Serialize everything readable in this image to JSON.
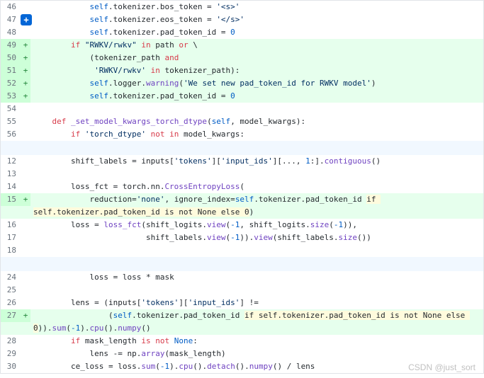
{
  "watermark": "CSDN @just_sort",
  "lines": [
    {
      "n": "46",
      "add": false,
      "parts": [
        [
          "            ",
          ""
        ],
        [
          "self",
          "self"
        ],
        [
          ".tokenizer.bos_token = ",
          ""
        ],
        [
          "'<s>'",
          "str"
        ]
      ]
    },
    {
      "n": "47",
      "add": false,
      "badge": true,
      "parts": [
        [
          "            ",
          ""
        ],
        [
          "self",
          "self"
        ],
        [
          ".tokenizer.eos_token = ",
          ""
        ],
        [
          "'</s>'",
          "str"
        ]
      ]
    },
    {
      "n": "48",
      "add": false,
      "parts": [
        [
          "            ",
          ""
        ],
        [
          "self",
          "self"
        ],
        [
          ".tokenizer.pad_token_id = ",
          ""
        ],
        [
          "0",
          "num"
        ]
      ]
    },
    {
      "n": "49",
      "add": true,
      "parts": [
        [
          "        ",
          ""
        ],
        [
          "if",
          "kw"
        ],
        [
          " ",
          ""
        ],
        [
          "\"RWKV/rwkv\"",
          "str"
        ],
        [
          " ",
          ""
        ],
        [
          "in",
          "kw"
        ],
        [
          " path ",
          ""
        ],
        [
          "or",
          "kw"
        ],
        [
          " \\",
          ""
        ]
      ]
    },
    {
      "n": "50",
      "add": true,
      "parts": [
        [
          "            (tokenizer_path ",
          ""
        ],
        [
          "and",
          "kw"
        ]
      ]
    },
    {
      "n": "51",
      "add": true,
      "parts": [
        [
          "             ",
          ""
        ],
        [
          "'RWKV/rwkv'",
          "str"
        ],
        [
          " ",
          ""
        ],
        [
          "in",
          "kw"
        ],
        [
          " tokenizer_path):",
          ""
        ]
      ]
    },
    {
      "n": "52",
      "add": true,
      "parts": [
        [
          "            ",
          ""
        ],
        [
          "self",
          "self"
        ],
        [
          ".logger.",
          ""
        ],
        [
          "warning",
          "fn"
        ],
        [
          "(",
          ""
        ],
        [
          "'We set new pad_token_id for RWKV model'",
          "str"
        ],
        [
          ")",
          ""
        ]
      ]
    },
    {
      "n": "53",
      "add": true,
      "parts": [
        [
          "            ",
          ""
        ],
        [
          "self",
          "self"
        ],
        [
          ".tokenizer.pad_token_id = ",
          ""
        ],
        [
          "0",
          "num"
        ]
      ]
    },
    {
      "n": "54",
      "add": false,
      "parts": [
        [
          "",
          ""
        ]
      ]
    },
    {
      "n": "55",
      "add": false,
      "parts": [
        [
          "    ",
          ""
        ],
        [
          "def",
          "kw"
        ],
        [
          " ",
          ""
        ],
        [
          "_set_model_kwargs_torch_dtype",
          "fn"
        ],
        [
          "(",
          ""
        ],
        [
          "self",
          "self"
        ],
        [
          ", model_kwargs):",
          ""
        ]
      ]
    },
    {
      "n": "56",
      "add": false,
      "parts": [
        [
          "        ",
          ""
        ],
        [
          "if",
          "kw"
        ],
        [
          " ",
          ""
        ],
        [
          "'torch_dtype'",
          "str"
        ],
        [
          " ",
          ""
        ],
        [
          "not",
          "kw"
        ],
        [
          " ",
          ""
        ],
        [
          "in",
          "kw"
        ],
        [
          " model_kwargs:",
          ""
        ]
      ]
    },
    {
      "hunk": true
    },
    {
      "n": "12",
      "add": false,
      "parts": [
        [
          "        shift_labels = inputs[",
          ""
        ],
        [
          "'tokens'",
          "str"
        ],
        [
          "][",
          ""
        ],
        [
          "'input_ids'",
          "str"
        ],
        [
          "][..., ",
          ""
        ],
        [
          "1",
          "num"
        ],
        [
          ":].",
          ""
        ],
        [
          "contiguous",
          "fn"
        ],
        [
          "()",
          ""
        ]
      ]
    },
    {
      "n": "13",
      "add": false,
      "parts": [
        [
          "",
          ""
        ]
      ]
    },
    {
      "n": "14",
      "add": false,
      "parts": [
        [
          "        loss_fct = torch.nn.",
          ""
        ],
        [
          "CrossEntropyLoss",
          "fn"
        ],
        [
          "(",
          ""
        ]
      ]
    },
    {
      "n": "15",
      "add": true,
      "parts": [
        [
          "            reduction=",
          ""
        ],
        [
          "'none'",
          "str"
        ],
        [
          ", ignore_index=",
          ""
        ],
        [
          "self",
          "self"
        ],
        [
          ".tokenizer.pad_token_id ",
          ""
        ],
        [
          "if self.tokenizer.pad_token_id is not None else 0",
          "hl"
        ],
        [
          ")",
          ""
        ]
      ]
    },
    {
      "n": "16",
      "add": false,
      "parts": [
        [
          "        loss = ",
          ""
        ],
        [
          "loss_fct",
          "fn"
        ],
        [
          "(shift_logits.",
          ""
        ],
        [
          "view",
          "fn"
        ],
        [
          "(",
          ""
        ],
        [
          "-1",
          "num"
        ],
        [
          ", shift_logits.",
          ""
        ],
        [
          "size",
          "fn"
        ],
        [
          "(",
          ""
        ],
        [
          "-1",
          "num"
        ],
        [
          ")),",
          ""
        ]
      ]
    },
    {
      "n": "17",
      "add": false,
      "parts": [
        [
          "                        shift_labels.",
          ""
        ],
        [
          "view",
          "fn"
        ],
        [
          "(",
          ""
        ],
        [
          "-1",
          "num"
        ],
        [
          ")).",
          ""
        ],
        [
          "view",
          "fn"
        ],
        [
          "(shift_labels.",
          ""
        ],
        [
          "size",
          "fn"
        ],
        [
          "())",
          ""
        ]
      ]
    },
    {
      "n": "18",
      "add": false,
      "parts": [
        [
          "",
          ""
        ]
      ]
    },
    {
      "hunk": true
    },
    {
      "n": "24",
      "add": false,
      "parts": [
        [
          "            loss = loss * mask",
          ""
        ]
      ]
    },
    {
      "n": "25",
      "add": false,
      "parts": [
        [
          "",
          ""
        ]
      ]
    },
    {
      "n": "26",
      "add": false,
      "parts": [
        [
          "        lens = (inputs[",
          ""
        ],
        [
          "'tokens'",
          "str"
        ],
        [
          "][",
          ""
        ],
        [
          "'input_ids'",
          "str"
        ],
        [
          "] !=",
          ""
        ]
      ]
    },
    {
      "n": "27",
      "add": true,
      "parts": [
        [
          "                (",
          ""
        ],
        [
          "self",
          "self"
        ],
        [
          ".tokenizer.pad_token_id ",
          ""
        ],
        [
          "if self.tokenizer.pad_token_id is not None else 0",
          "hl"
        ],
        [
          ")).",
          ""
        ],
        [
          "sum",
          "fn"
        ],
        [
          "(",
          ""
        ],
        [
          "-1",
          "num"
        ],
        [
          ").",
          ""
        ],
        [
          "cpu",
          "fn"
        ],
        [
          "().",
          ""
        ],
        [
          "numpy",
          "fn"
        ],
        [
          "()",
          ""
        ]
      ]
    },
    {
      "n": "28",
      "add": false,
      "parts": [
        [
          "        ",
          ""
        ],
        [
          "if",
          "kw"
        ],
        [
          " mask_length ",
          ""
        ],
        [
          "is",
          "kw"
        ],
        [
          " ",
          ""
        ],
        [
          "not",
          "kw"
        ],
        [
          " ",
          ""
        ],
        [
          "None",
          "num"
        ],
        [
          ":",
          ""
        ]
      ]
    },
    {
      "n": "29",
      "add": false,
      "parts": [
        [
          "            lens -= np.",
          ""
        ],
        [
          "array",
          "fn"
        ],
        [
          "(mask_length)",
          ""
        ]
      ]
    },
    {
      "n": "30",
      "add": false,
      "parts": [
        [
          "        ce_loss = loss.",
          ""
        ],
        [
          "sum",
          "fn"
        ],
        [
          "(",
          ""
        ],
        [
          "-1",
          "num"
        ],
        [
          ").",
          ""
        ],
        [
          "cpu",
          "fn"
        ],
        [
          "().",
          ""
        ],
        [
          "detach",
          "fn"
        ],
        [
          "().",
          ""
        ],
        [
          "numpy",
          "fn"
        ],
        [
          "() / lens",
          ""
        ]
      ]
    }
  ]
}
